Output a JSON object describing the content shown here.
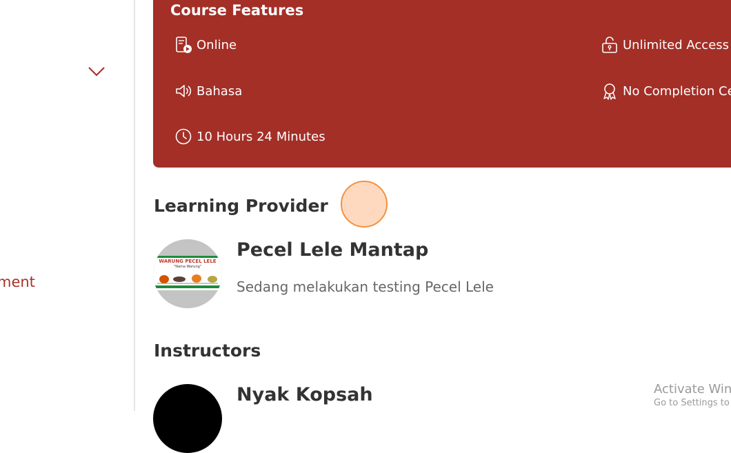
{
  "sidebar": {
    "chevron_icon": "chevron-down-icon",
    "partial_item_label": "ment",
    "accent_color": "#a83228"
  },
  "course_features": {
    "title": "Course Features",
    "background_color": "#a32f27",
    "items": [
      {
        "label": "Online",
        "icon": "online-video-icon"
      },
      {
        "label": "Unlimited Access",
        "icon": "unlock-icon"
      },
      {
        "label": "Bahasa",
        "icon": "speaker-icon"
      },
      {
        "label": "No Completion Ce",
        "icon": "award-icon"
      },
      {
        "label": "10 Hours 24 Minutes",
        "icon": "clock-icon"
      }
    ]
  },
  "learning_provider": {
    "section_title": "Learning Provider",
    "name": "Pecel Lele Mantap",
    "description": "Sedang melakukan testing Pecel Lele",
    "logo_title": "WARUNG PECEL LELE",
    "logo_subtitle": "\"Nama Warung\""
  },
  "instructors": {
    "section_title": "Instructors",
    "items": [
      {
        "name": "Nyak Kopsah"
      }
    ]
  },
  "watermark": {
    "line1": "Activate Win",
    "line2": "Go to Settings to"
  }
}
